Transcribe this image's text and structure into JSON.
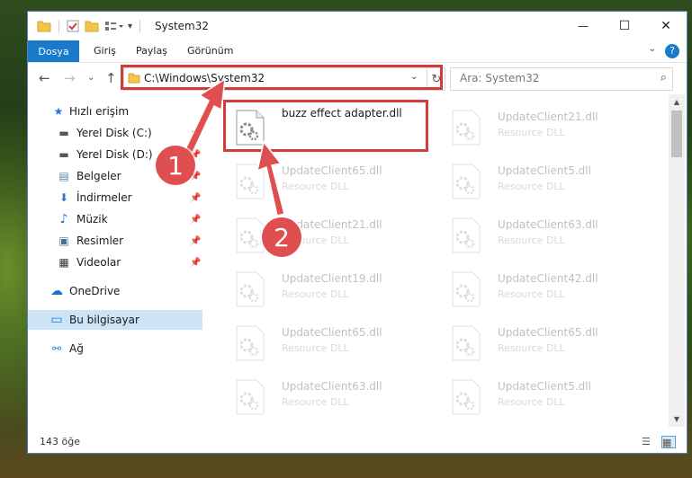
{
  "window": {
    "title": "System32",
    "controls": {
      "minimize": "—",
      "maximize": "☐",
      "close": "✕"
    }
  },
  "ribbon": {
    "file_tab": "Dosya",
    "tabs": [
      "Giriş",
      "Paylaş",
      "Görünüm"
    ],
    "help": "?",
    "collapse": "⌄"
  },
  "nav": {
    "back": "←",
    "forward": "→",
    "dropdown": "⌄",
    "up": "↑",
    "address": "C:\\Windows\\System32",
    "address_dropdown": "⌄",
    "refresh": "↻",
    "search_placeholder": "Ara: System32",
    "search_icon": "⌕"
  },
  "sidebar": {
    "items": [
      {
        "label": "Hızlı erişim",
        "icon": "star-icon",
        "glyph": "★",
        "color": "#2b77d1",
        "pinned": false
      },
      {
        "label": "Yerel Disk (C:)",
        "icon": "drive-icon",
        "glyph": "▬",
        "color": "#555555",
        "pinned": true
      },
      {
        "label": "Yerel Disk (D:)",
        "icon": "drive-icon",
        "glyph": "▬",
        "color": "#555555",
        "pinned": true
      },
      {
        "label": "Belgeler",
        "icon": "documents-icon",
        "glyph": "▤",
        "color": "#5a7fa8",
        "pinned": true
      },
      {
        "label": "İndirmeler",
        "icon": "download-icon",
        "glyph": "⬇",
        "color": "#2b77d1",
        "pinned": true
      },
      {
        "label": "Müzik",
        "icon": "music-icon",
        "glyph": "♪",
        "color": "#2b77d1",
        "pinned": true
      },
      {
        "label": "Resimler",
        "icon": "pictures-icon",
        "glyph": "▣",
        "color": "#4d6f94",
        "pinned": true
      },
      {
        "label": "Videolar",
        "icon": "videos-icon",
        "glyph": "▦",
        "color": "#333333",
        "pinned": true
      },
      {
        "label": "OneDrive",
        "icon": "cloud-icon",
        "glyph": "☁",
        "color": "#1e73c9",
        "pinned": false
      },
      {
        "label": "Bu bilgisayar",
        "icon": "computer-icon",
        "glyph": "▭",
        "color": "#2b77d1",
        "pinned": false
      },
      {
        "label": "Ağ",
        "icon": "network-icon",
        "glyph": "⚯",
        "color": "#2b77d1",
        "pinned": false
      }
    ],
    "pin_glyph": "📌"
  },
  "files": [
    {
      "name": "buzz effect adapter.dll",
      "type": "",
      "faded": false
    },
    {
      "name": "UpdateClient21.dll",
      "type": "Resource DLL",
      "faded": true
    },
    {
      "name": "UpdateClient65.dll",
      "type": "Resource DLL",
      "faded": true
    },
    {
      "name": "UpdateClient5.dll",
      "type": "Resource DLL",
      "faded": true
    },
    {
      "name": "UpdateClient21.dll",
      "type": "Resource DLL",
      "faded": true
    },
    {
      "name": "UpdateClient63.dll",
      "type": "Resource DLL",
      "faded": true
    },
    {
      "name": "UpdateClient19.dll",
      "type": "Resource DLL",
      "faded": true
    },
    {
      "name": "UpdateClient42.dll",
      "type": "Resource DLL",
      "faded": true
    },
    {
      "name": "UpdateClient65.dll",
      "type": "Resource DLL",
      "faded": true
    },
    {
      "name": "UpdateClient65.dll",
      "type": "Resource DLL",
      "faded": true
    },
    {
      "name": "UpdateClient63.dll",
      "type": "Resource DLL",
      "faded": true
    },
    {
      "name": "UpdateClient5.dll",
      "type": "Resource DLL",
      "faded": true
    }
  ],
  "status": {
    "item_count": "143 öğe",
    "details_view_icon": "☰",
    "tiles_view_icon": "▦"
  },
  "callouts": [
    "1",
    "2"
  ],
  "colors": {
    "accent": "#1979ca",
    "highlight": "#d23b3b",
    "callout": "#e04f4f",
    "selection": "#cce4f7"
  }
}
